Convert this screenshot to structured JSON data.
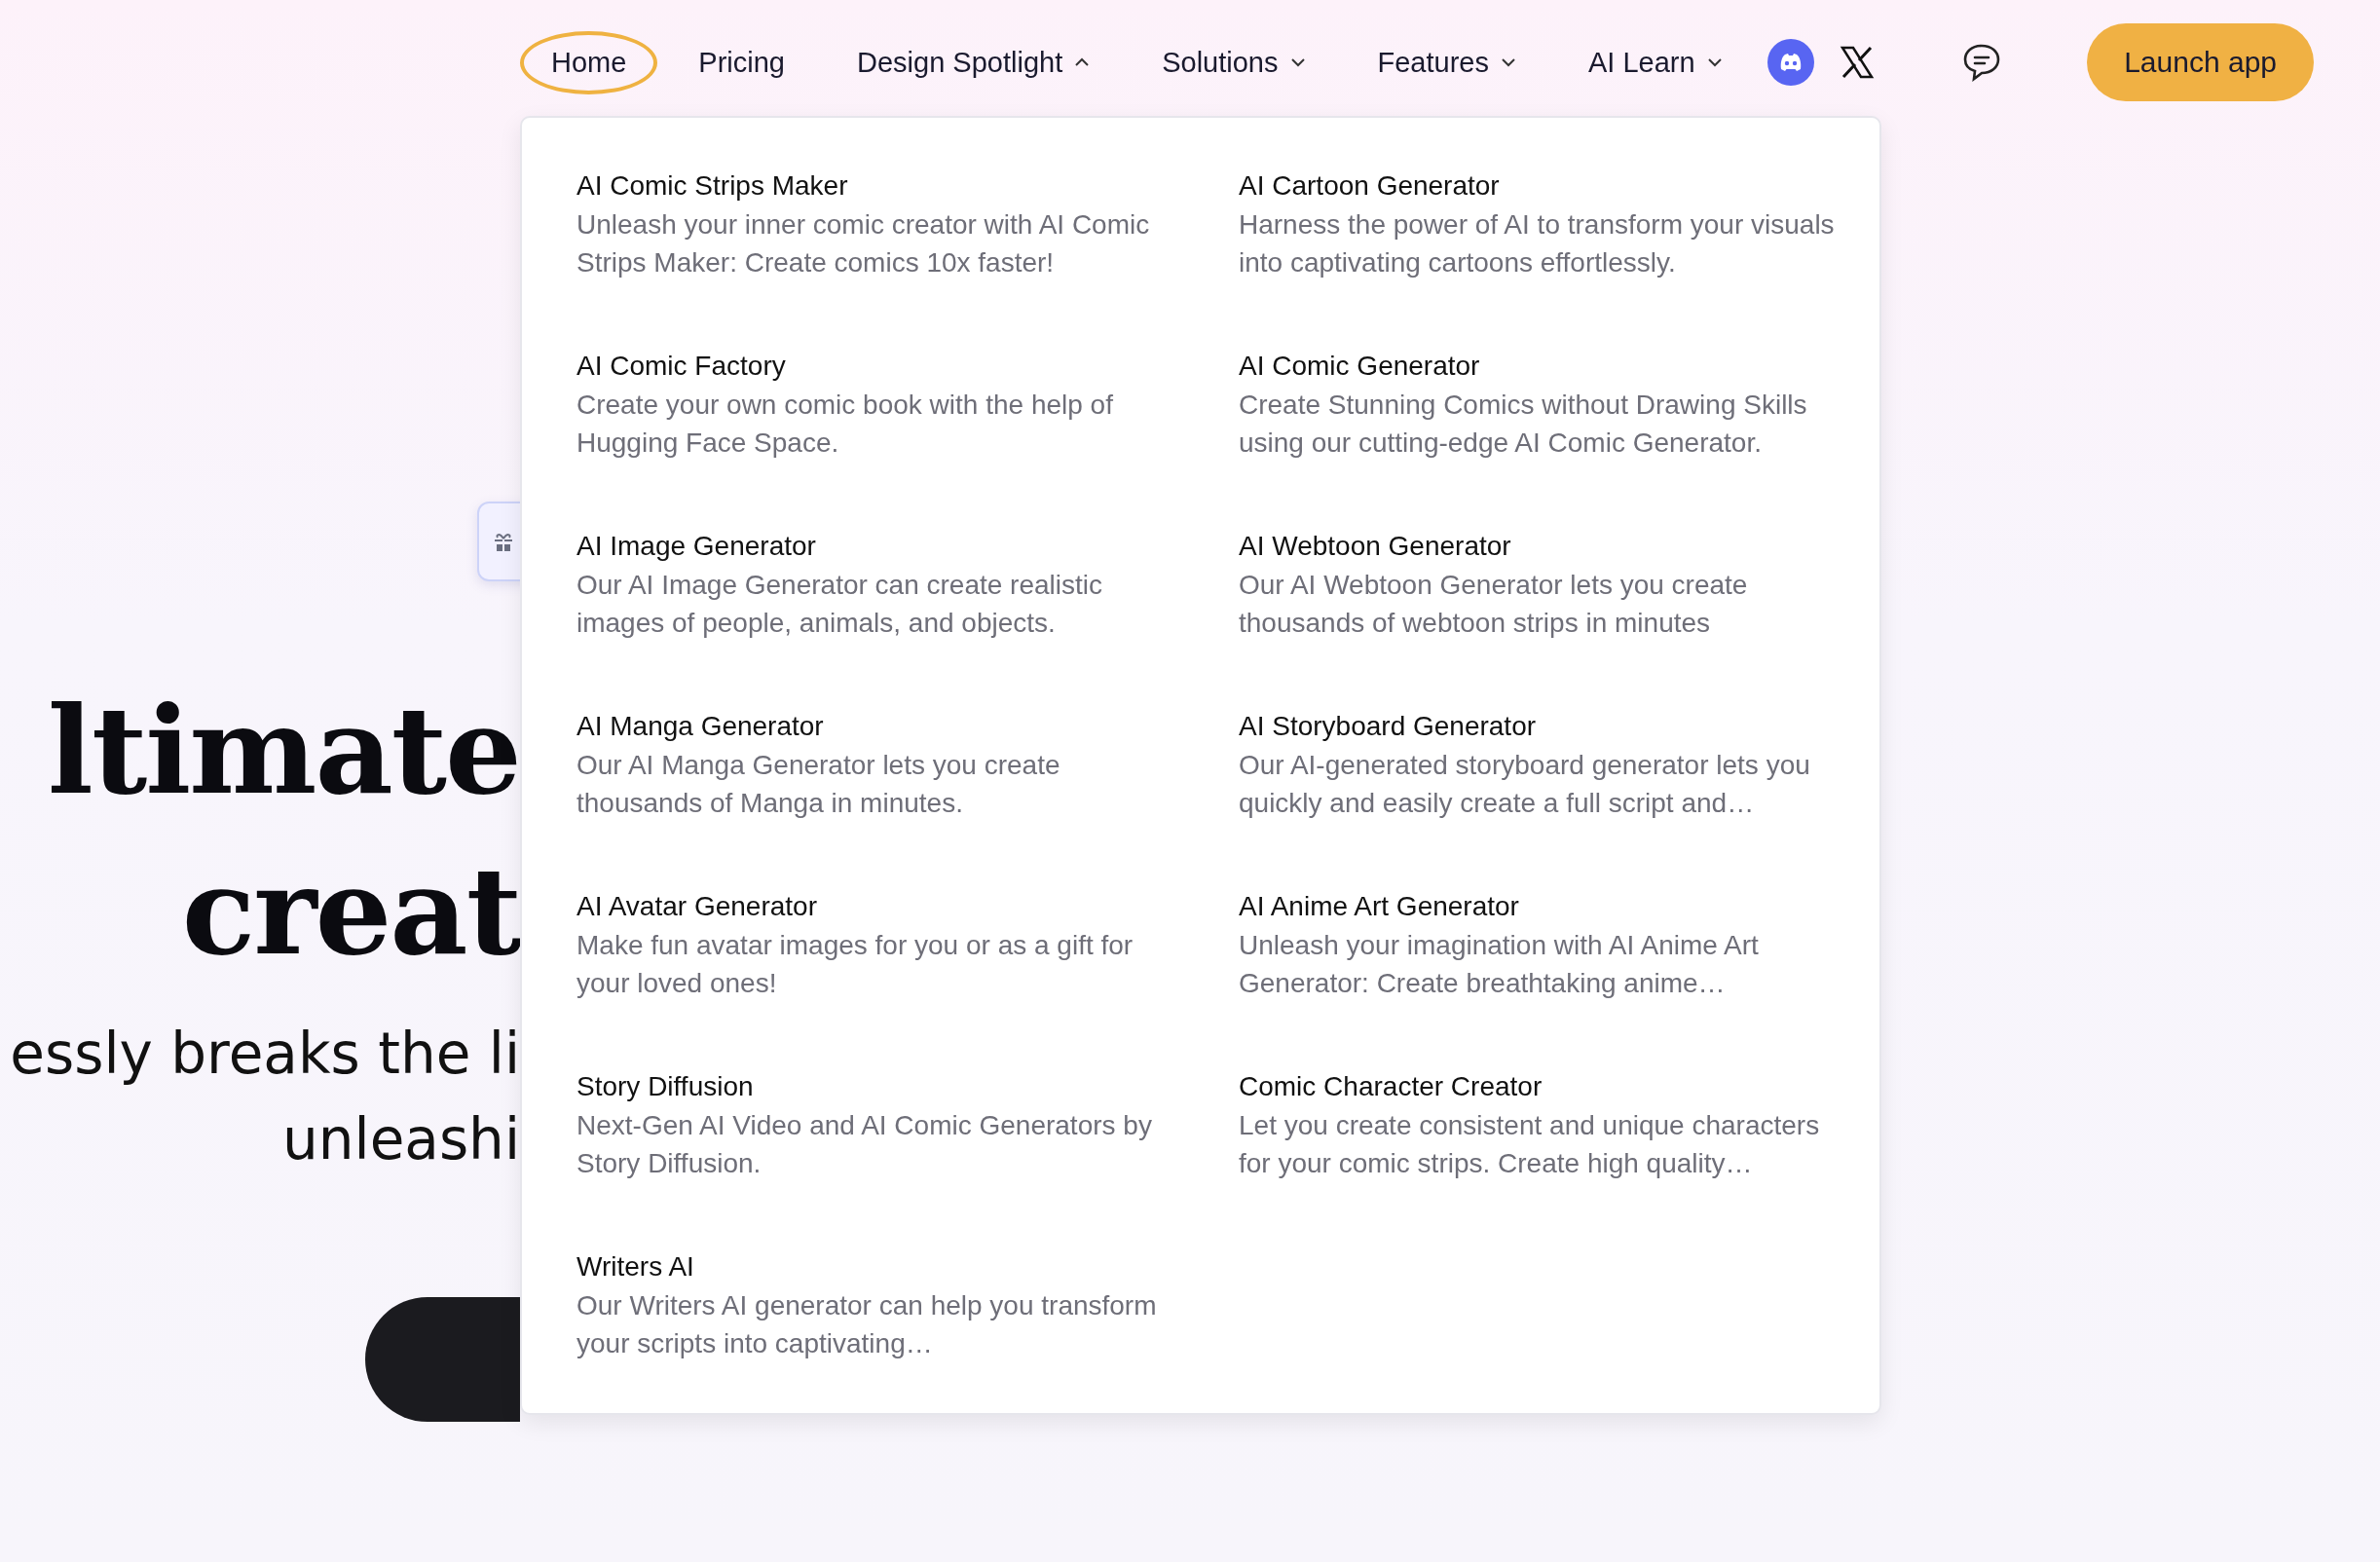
{
  "nav": {
    "items": [
      {
        "label": "Home",
        "kind": "link",
        "selected": true
      },
      {
        "label": "Pricing",
        "kind": "link",
        "selected": false
      },
      {
        "label": "Design Spotlight",
        "kind": "dropdown",
        "selected": false,
        "expanded": true
      },
      {
        "label": "Solutions",
        "kind": "dropdown",
        "selected": false,
        "expanded": false
      },
      {
        "label": "Features",
        "kind": "dropdown",
        "selected": false,
        "expanded": false
      },
      {
        "label": "AI Learn",
        "kind": "dropdown",
        "selected": false,
        "expanded": false
      }
    ],
    "launch_button": "Launch app"
  },
  "hero": {
    "title_lines": [
      "ltimate",
      "creat"
    ],
    "subtitle_lines": [
      "essly breaks the li",
      "unleashi"
    ]
  },
  "dropdown": {
    "items": [
      {
        "title": "AI Comic Strips Maker",
        "description": "Unleash your inner comic creator with AI Comic Strips Maker: Create comics 10x faster!"
      },
      {
        "title": "AI Cartoon Generator",
        "description": "Harness the power of AI to transform your visuals into captivating cartoons effortlessly."
      },
      {
        "title": "AI Comic Factory",
        "description": "Create your own comic book with the help of Hugging Face Space."
      },
      {
        "title": "AI Comic Generator",
        "description": "Create Stunning Comics without Drawing Skills using our cutting-edge AI Comic Generator."
      },
      {
        "title": "AI Image Generator",
        "description": "Our AI Image Generator can create realistic images of people, animals, and objects."
      },
      {
        "title": "AI Webtoon Generator",
        "description": "Our AI Webtoon Generator lets you create thousands of webtoon strips in minutes"
      },
      {
        "title": "AI Manga Generator",
        "description": "Our AI Manga Generator lets you create thousands of Manga in minutes."
      },
      {
        "title": "AI Storyboard Generator",
        "description": "Our AI-generated storyboard generator lets you quickly and easily create a full script and…"
      },
      {
        "title": "AI Avatar Generator",
        "description": "Make fun avatar images for you or as a gift for your loved ones!"
      },
      {
        "title": "AI Anime Art Generator",
        "description": "Unleash your imagination with AI Anime Art Generator: Create breathtaking anime…"
      },
      {
        "title": "Story Diffusion",
        "description": "Next-Gen AI Video and AI Comic Generators by Story Diffusion."
      },
      {
        "title": "Comic Character Creator",
        "description": "Let you create consistent and unique characters for your comic strips. Create high quality…"
      },
      {
        "title": "Writers AI",
        "description": "Our Writers AI generator can help you transform your scripts into captivating…"
      }
    ]
  }
}
